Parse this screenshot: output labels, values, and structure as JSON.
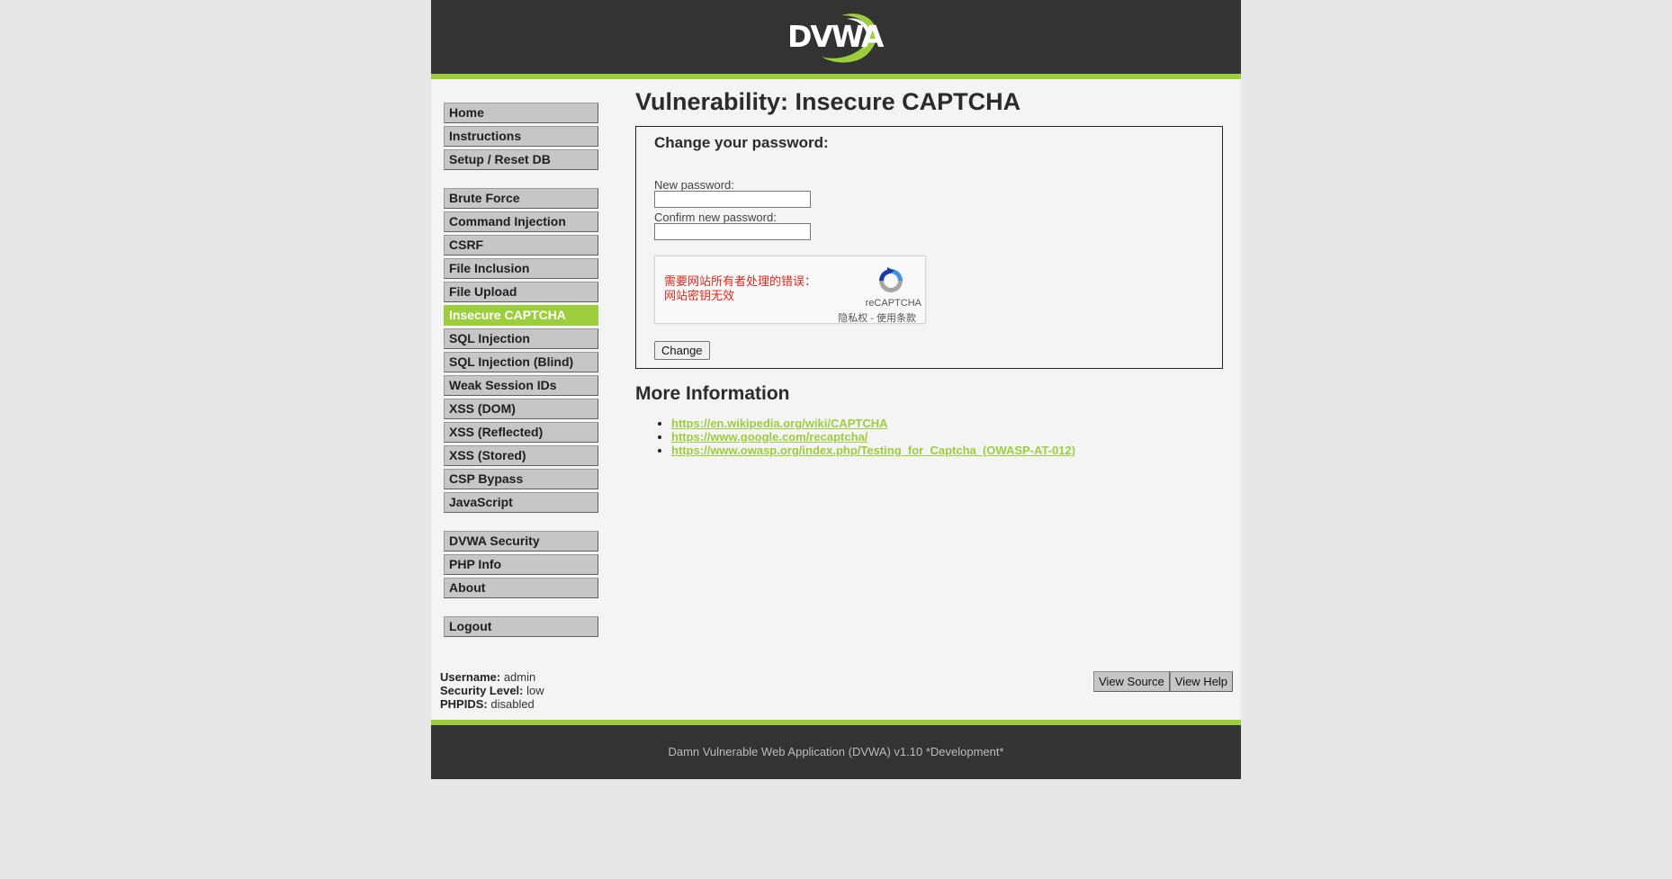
{
  "header": {
    "logo_text": "DVWA"
  },
  "menu": {
    "group1": [
      "Home",
      "Instructions",
      "Setup / Reset DB"
    ],
    "group2": [
      "Brute Force",
      "Command Injection",
      "CSRF",
      "File Inclusion",
      "File Upload",
      "Insecure CAPTCHA",
      "SQL Injection",
      "SQL Injection (Blind)",
      "Weak Session IDs",
      "XSS (DOM)",
      "XSS (Reflected)",
      "XSS (Stored)",
      "CSP Bypass",
      "JavaScript"
    ],
    "group3": [
      "DVWA Security",
      "PHP Info",
      "About"
    ],
    "group4": [
      "Logout"
    ],
    "selected": "Insecure CAPTCHA"
  },
  "main": {
    "title": "Vulnerability: Insecure CAPTCHA",
    "form": {
      "heading": "Change your password:",
      "new_password_label": "New password:",
      "new_password_value": "",
      "confirm_password_label": "Confirm new password:",
      "confirm_password_value": "",
      "change_button": "Change"
    },
    "captcha": {
      "error_line1": "需要网站所有者处理的错误：",
      "error_line2": "网站密钥无效",
      "brand": "reCAPTCHA",
      "terms": "隐私权 - 使用条款"
    },
    "more_info_heading": "More Information",
    "links": [
      "https://en.wikipedia.org/wiki/CAPTCHA",
      "https://www.google.com/recaptcha/",
      "https://www.owasp.org/index.php/Testing_for_Captcha_(OWASP-AT-012)"
    ]
  },
  "user_info": {
    "username_label": "Username:",
    "username": "admin",
    "security_label": "Security Level:",
    "security": "low",
    "phpids_label": "PHPIDS:",
    "phpids": "disabled"
  },
  "buttons": {
    "view_source": "View Source",
    "view_help": "View Help"
  },
  "footer": {
    "text": "Damn Vulnerable Web Application (DVWA) v1.10 *Development*"
  },
  "colors": {
    "accent": "#9ccd3c",
    "header_bg": "#333333",
    "menu_bg": "#c6c6c6"
  }
}
